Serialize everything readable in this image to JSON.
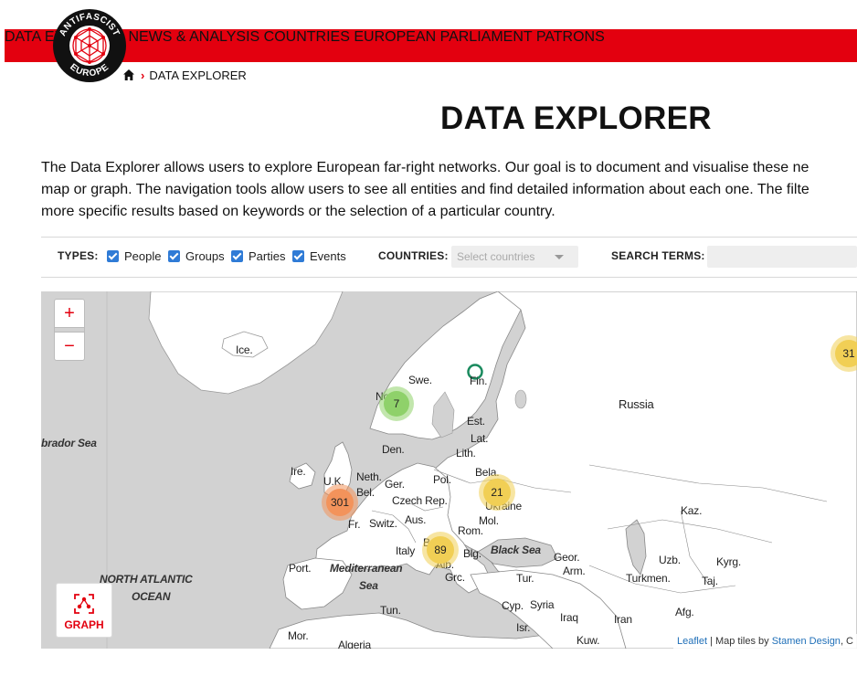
{
  "brand": {
    "logo_top": "ANTIFASCIST",
    "logo_bottom": "EUROPE"
  },
  "nav": {
    "items": [
      {
        "label": "DATA EXPLORER"
      },
      {
        "label": "NEWS & ANALYSIS"
      },
      {
        "label": "COUNTRIES"
      },
      {
        "label": "EUROPEAN PARLIAMENT"
      },
      {
        "label": "PATRONS"
      }
    ]
  },
  "breadcrumb": {
    "current": "DATA EXPLORER"
  },
  "page": {
    "title": "DATA EXPLORER",
    "intro_lines": [
      "The Data Explorer allows users to explore European far-right networks. Our goal is to document and visualise these ne",
      "map or graph. The navigation tools allow users to see all entities and find detailed information about each one. The filte",
      "more specific results based on keywords or the selection of a particular country."
    ]
  },
  "filters": {
    "types_label": "TYPES:",
    "types": [
      {
        "label": "People",
        "checked": true
      },
      {
        "label": "Groups",
        "checked": true
      },
      {
        "label": "Parties",
        "checked": true
      },
      {
        "label": "Events",
        "checked": true
      }
    ],
    "countries_label": "COUNTRIES:",
    "countries_placeholder": "Select countries",
    "search_label": "SEARCH TERMS:",
    "search_value": ""
  },
  "map": {
    "zoom_in": "+",
    "zoom_out": "−",
    "graph_label": "GRAPH",
    "labels": {
      "iceland": "Ice.",
      "norway": "Nor.",
      "sweden": "Swe.",
      "finland": "Fin.",
      "russia": "Russia",
      "estonia": "Est.",
      "latvia": "Lat.",
      "lithuania": "Lith.",
      "denmark": "Den.",
      "belarus": "Bela.",
      "ireland": "Ire.",
      "uk": "U.K.",
      "netherlands": "Neth.",
      "germany": "Ger.",
      "poland": "Pol.",
      "belgium": "Bel.",
      "czech": "Czech Rep.",
      "ukraine": "Ukraine",
      "kazakhstan": "Kaz.",
      "france": "Fr.",
      "switzerland": "Switz.",
      "austria": "Aus.",
      "moldova": "Mol.",
      "romania": "Rom.",
      "italy": "Italy",
      "bosnia": "B",
      "bulgaria": "Blg.",
      "black_sea": "Black Sea",
      "georgia": "Geor.",
      "armenia": "Arm.",
      "uzbekistan": "Uzb.",
      "kyrgyzstan": "Kyrg.",
      "portugal": "Port.",
      "albania": "Alb.",
      "greece": "Grc.",
      "turkey": "Tur.",
      "turkmenistan": "Turkmen.",
      "tajikistan": "Taj.",
      "mediterranean_1": "Mediterranean",
      "mediterranean_2": "Sea",
      "north_atlantic_1": "NORTH ATLANTIC",
      "north_atlantic_2": "OCEAN",
      "labrador": "brador Sea",
      "tunisia": "Tun.",
      "cyprus": "Cyp.",
      "syria": "Syria",
      "iraq": "Iraq",
      "iran": "Iran",
      "afghanistan": "Afg.",
      "israel": "Isr.",
      "morocco": "Mor.",
      "algeria": "Algeria",
      "kuwait": "Kuw."
    },
    "clusters": [
      {
        "name": "norway",
        "count": "7",
        "color": "#8fd16a"
      },
      {
        "name": "uk",
        "count": "301",
        "color": "#f3935b"
      },
      {
        "name": "ukraine",
        "count": "21",
        "color": "#f1cf55"
      },
      {
        "name": "balkans",
        "count": "89",
        "color": "#f1cf55"
      },
      {
        "name": "east",
        "count": "31",
        "color": "#f1cf55"
      }
    ],
    "attribution": {
      "leaflet": "Leaflet",
      "sep": " | Map tiles by ",
      "stamen": "Stamen Design",
      "tail": ", C"
    }
  },
  "colors": {
    "accent": "#e3000f",
    "land": "#ffffff",
    "water": "#d2d2d2"
  }
}
